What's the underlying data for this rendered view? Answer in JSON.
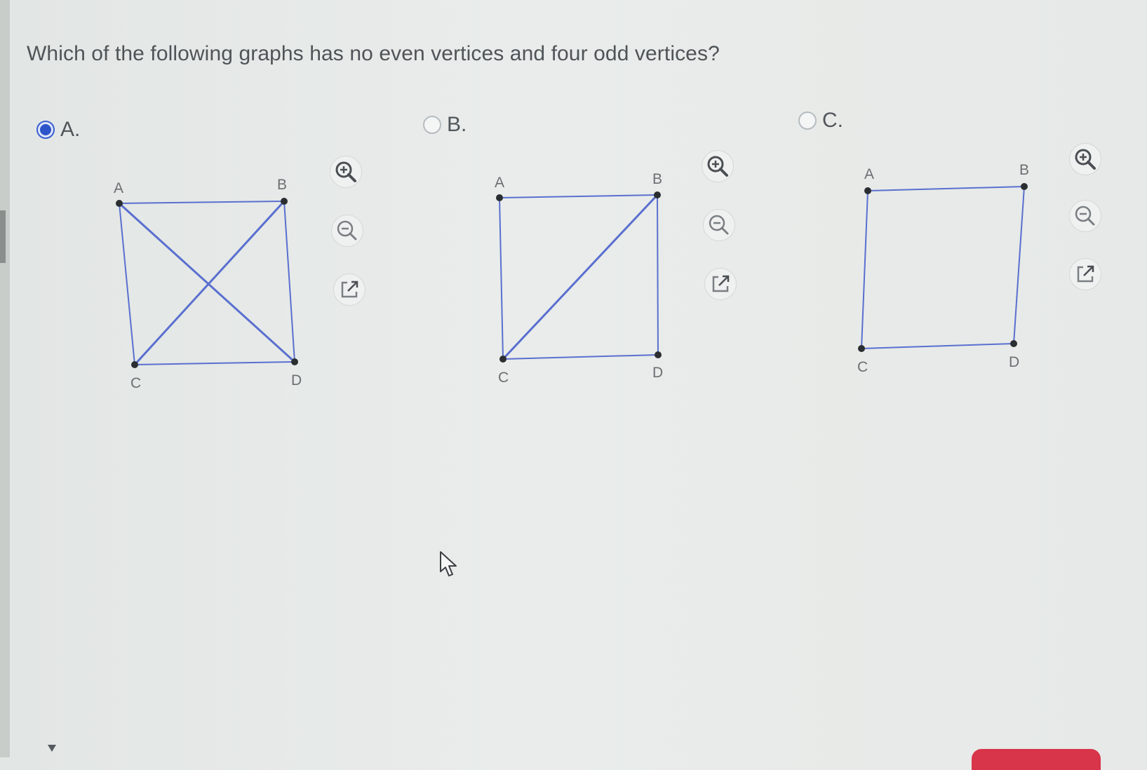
{
  "question": "Which of the following graphs has no even vertices and four odd vertices?",
  "options": [
    {
      "letter": "A.",
      "selected": true,
      "vertices": [
        "A",
        "B",
        "C",
        "D"
      ],
      "edges": [
        [
          "A",
          "B"
        ],
        [
          "A",
          "C"
        ],
        [
          "B",
          "D"
        ],
        [
          "C",
          "D"
        ],
        [
          "A",
          "D"
        ],
        [
          "B",
          "C"
        ]
      ]
    },
    {
      "letter": "B.",
      "selected": false,
      "vertices": [
        "A",
        "B",
        "C",
        "D"
      ],
      "edges": [
        [
          "A",
          "B"
        ],
        [
          "A",
          "C"
        ],
        [
          "B",
          "D"
        ],
        [
          "C",
          "D"
        ],
        [
          "B",
          "C"
        ]
      ]
    },
    {
      "letter": "C.",
      "selected": false,
      "vertices": [
        "A",
        "B",
        "C",
        "D"
      ],
      "edges": [
        [
          "A",
          "B"
        ],
        [
          "A",
          "C"
        ],
        [
          "B",
          "D"
        ],
        [
          "C",
          "D"
        ]
      ]
    }
  ],
  "tools": {
    "zoom_in": "zoom-in-icon",
    "zoom_out": "zoom-out-icon",
    "open_new": "open-in-new-window-icon"
  },
  "colors": {
    "edge": "#5a6fd0",
    "vertex": "#2b2e31",
    "selected": "#2d55c9"
  }
}
